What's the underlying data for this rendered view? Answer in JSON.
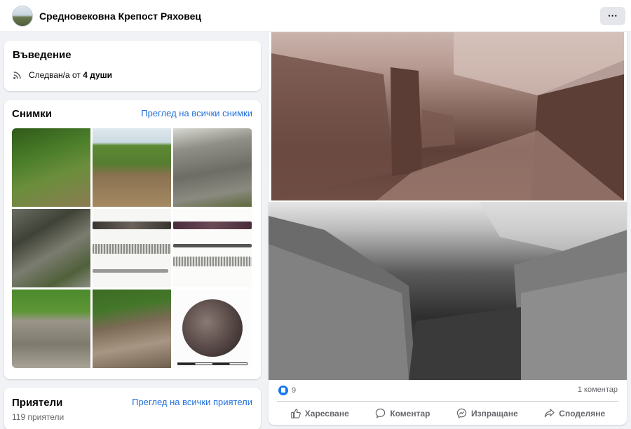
{
  "header": {
    "page_name": "Средновековна Крепост Ряховец",
    "more_label": "···"
  },
  "intro": {
    "title": "Въведение",
    "followers_prefix": "Следван/а от ",
    "followers_count": "4 души"
  },
  "photos": {
    "title": "Снимки",
    "see_all": "Преглед на всички снимки"
  },
  "friends": {
    "title": "Приятели",
    "see_all": "Преглед на всички приятели",
    "count": "119 приятели"
  },
  "post": {
    "likes": "9",
    "comments": "1 коментар",
    "actions": {
      "like": "Харесване",
      "comment": "Коментар",
      "send": "Изпращане",
      "share": "Споделяне"
    }
  },
  "colors": {
    "link": "#216fdb",
    "like_blue": "#1877f2",
    "muted_text": "#65676b",
    "page_bg": "#f0f2f5"
  }
}
